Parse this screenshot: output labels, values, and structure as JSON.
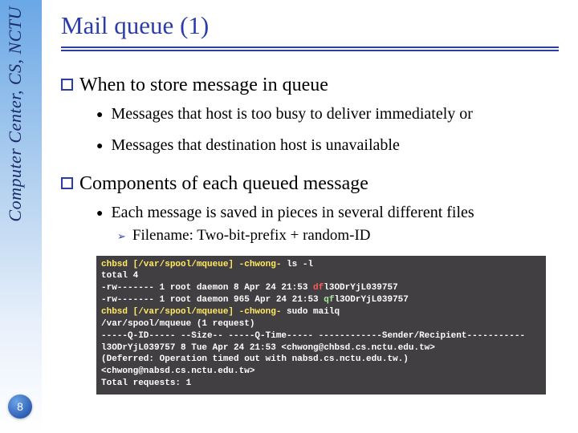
{
  "sidebar": {
    "vertical_label": "Computer Center, CS, NCTU",
    "page_number": "8"
  },
  "title": "Mail queue (1)",
  "sections": [
    {
      "heading": "When to store message in queue",
      "bullets": [
        "Messages that host is too busy to deliver immediately or",
        "Messages that destination host is unavailable"
      ]
    },
    {
      "heading": "Components of each queued message",
      "bullets": [
        "Each message is saved in pieces in several different files"
      ],
      "sub": "Filename: Two-bit-prefix + random-ID"
    }
  ],
  "terminal": {
    "line1_pre": "chbsd [/var/spool/mqueue] -chwong- ",
    "line1_cmd": "ls -l",
    "line2": "total 4",
    "line3_pre": "-rw-------  1 root  daemon    8 Apr 24 21:53 ",
    "line3_df": "df",
    "line3_id": "l3ODrYjL039757",
    "line4_pre": "-rw-------  1 root  daemon  965 Apr 24 21:53 ",
    "line4_qf": "qf",
    "line4_id": "l3ODrYjL039757",
    "line5_pre": "chbsd [/var/spool/mqueue] -chwong- ",
    "line5_cmd": "sudo mailq",
    "line6": "                /var/spool/mqueue (1 request)",
    "line7": "-----Q-ID----- --Size-- -----Q-Time----- ------------Sender/Recipient-----------",
    "line8": "l3ODrYjL039757        8 Tue Apr 24 21:53 <chwong@chbsd.cs.nctu.edu.tw>",
    "line9": "                 (Deferred: Operation timed out with nabsd.cs.nctu.edu.tw.)",
    "line10": "                                         <chwong@nabsd.cs.nctu.edu.tw>",
    "line11": "                Total requests: 1"
  }
}
